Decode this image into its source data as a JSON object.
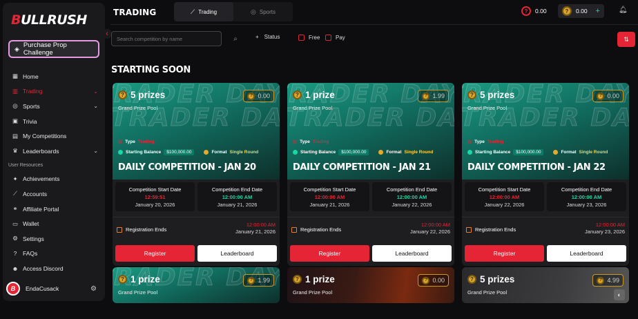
{
  "app": {
    "logo_mark": "B",
    "logo_text": "ULLRUSH",
    "purchase_label": "Purchase Prop Challenge",
    "page_title": "TRADING"
  },
  "tabs": [
    {
      "label": "Trading",
      "icon": "chart-icon",
      "active": true
    },
    {
      "label": "Sports",
      "icon": "ball-icon",
      "active": false
    }
  ],
  "balances": {
    "cash": "0.00",
    "coins": "0.00"
  },
  "sidebar": {
    "items": [
      {
        "label": "Home",
        "icon": "grid-icon"
      },
      {
        "label": "Trading",
        "icon": "chart-icon",
        "active": true,
        "chevron": true
      },
      {
        "label": "Sports",
        "icon": "ball-icon",
        "chevron": true
      },
      {
        "label": "Trivia",
        "icon": "quiz-icon"
      },
      {
        "label": "My Competitions",
        "icon": "bar-chart-icon"
      },
      {
        "label": "Leaderboards",
        "icon": "trophy-icon",
        "chevron": true
      }
    ],
    "section_label": "User Resources",
    "resources": [
      {
        "label": "Achievements",
        "icon": "star-icon"
      },
      {
        "label": "Accounts",
        "icon": "line-chart-icon"
      },
      {
        "label": "Affiliate Portal",
        "icon": "link-icon"
      },
      {
        "label": "Wallet",
        "icon": "wallet-icon"
      },
      {
        "label": "Settings",
        "icon": "gear-icon"
      },
      {
        "label": "FAQs",
        "icon": "help-icon"
      },
      {
        "label": "Access Discord",
        "icon": "discord-icon"
      }
    ],
    "user_name": "EndaCusack"
  },
  "filters": {
    "search_placeholder": "Search competition by name",
    "status_label": "Status",
    "free_label": "Free",
    "pay_label": "Pay"
  },
  "section_title": "STARTING SOON",
  "common": {
    "grand_prize_label": "Grand Prize Pool",
    "type_label": "Type",
    "type_value": "Trading",
    "starting_balance_label": "Starting Balance",
    "starting_balance_value": "$100,000.00",
    "format_label": "Format",
    "format_value": "Single Round",
    "start_date_label": "Competition Start Date",
    "end_date_label": "Competition End Date",
    "registration_label": "Registration Ends",
    "register_label": "Register",
    "leaderboard_label": "Leaderboard",
    "watermark": "TRADER DAY"
  },
  "cards": [
    {
      "prizes": "5 prizes",
      "entry": "0.00",
      "title": "DAILY COMPETITION - JAN 20",
      "start_time": "12:59:51",
      "start_date": "January 20, 2026",
      "end_time": "12:00:00 AM",
      "end_date": "January 21, 2026",
      "reg_time": "12:00:00 AM",
      "reg_date": "January 21, 2026"
    },
    {
      "prizes": "1 prize",
      "entry": "1.99",
      "title": "DAILY COMPETITION - JAN 21",
      "start_time": "12:00:00 AM",
      "start_date": "January 21, 2026",
      "end_time": "12:00:00 AM",
      "end_date": "January 22, 2026",
      "reg_time": "12:00:00 AM",
      "reg_date": "January 22, 2026"
    },
    {
      "prizes": "5 prizes",
      "entry": "0.00",
      "title": "DAILY COMPETITION - JAN 22",
      "start_time": "12:00:00 AM",
      "start_date": "January 22, 2026",
      "end_time": "12:00:00 AM",
      "end_date": "January 23, 2026",
      "reg_time": "12:00:00 AM",
      "reg_date": "January 23, 2026"
    }
  ],
  "partial_cards": [
    {
      "prizes": "1 prize",
      "entry": "1.99"
    },
    {
      "prizes": "1 prize",
      "entry": "0.00"
    },
    {
      "prizes": "5 prizes",
      "entry": "4.99"
    }
  ],
  "colors": {
    "accent": "#e52535",
    "teal": "#1dd6a5",
    "gold": "#d9a52a"
  }
}
